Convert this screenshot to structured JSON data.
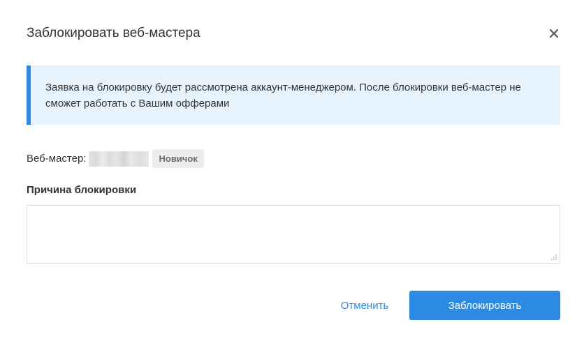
{
  "dialog": {
    "title": "Заблокировать веб-мастера",
    "close_icon": "close-icon"
  },
  "info": {
    "text": "Заявка на блокировку будет рассмотрена аккаунт-менеджером. После блокировки веб-мастер не сможет работать с Вашим офферами",
    "accent_color": "#2d8ae2",
    "background_color": "#e7f3fc"
  },
  "webmaster": {
    "label": "Веб-мастер:",
    "badge": "Новичок"
  },
  "reason": {
    "label": "Причина блокировки",
    "value": "",
    "placeholder": ""
  },
  "actions": {
    "cancel_label": "Отменить",
    "submit_label": "Заблокировать",
    "primary_color": "#2d8ae2"
  }
}
